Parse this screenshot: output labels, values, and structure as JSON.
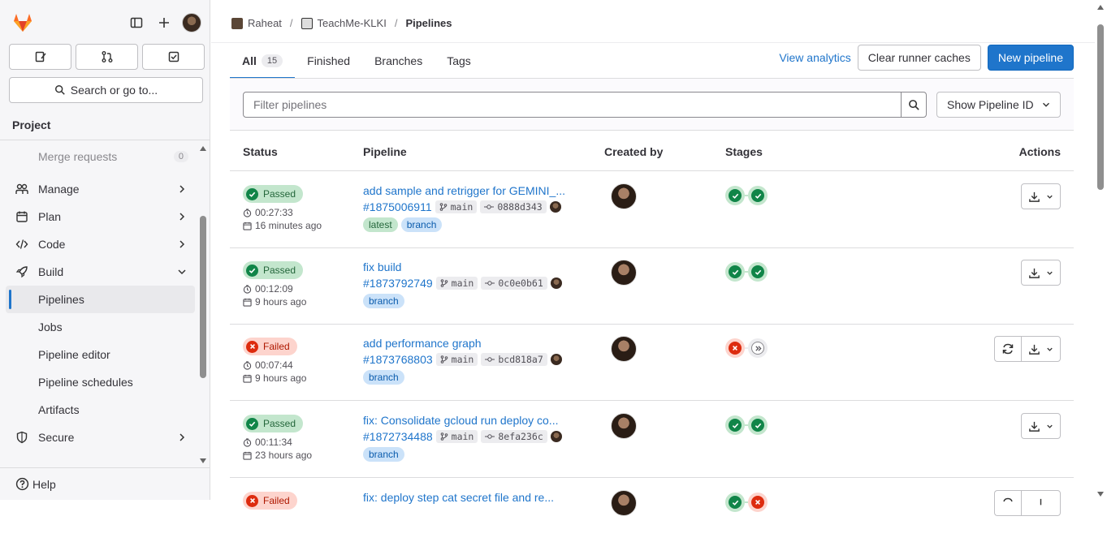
{
  "sidebar": {
    "search_label": "Search or go to...",
    "section_title": "Project",
    "items": [
      {
        "label": "Merge requests",
        "count": "0"
      },
      {
        "label": "Manage"
      },
      {
        "label": "Plan"
      },
      {
        "label": "Code"
      },
      {
        "label": "Build"
      },
      {
        "label": "Pipelines"
      },
      {
        "label": "Jobs"
      },
      {
        "label": "Pipeline editor"
      },
      {
        "label": "Pipeline schedules"
      },
      {
        "label": "Artifacts"
      },
      {
        "label": "Secure"
      }
    ],
    "help_label": "Help"
  },
  "breadcrumb": {
    "user": "Raheat",
    "project": "TeachMe-KLKI",
    "current": "Pipelines"
  },
  "tabs": [
    {
      "label": "All",
      "count": "15"
    },
    {
      "label": "Finished"
    },
    {
      "label": "Branches"
    },
    {
      "label": "Tags"
    }
  ],
  "actions": {
    "view_analytics": "View analytics",
    "clear_caches": "Clear runner caches",
    "new_pipeline": "New pipeline"
  },
  "filter": {
    "placeholder": "Filter pipelines",
    "show_id": "Show Pipeline ID"
  },
  "columns": {
    "status": "Status",
    "pipeline": "Pipeline",
    "created_by": "Created by",
    "stages": "Stages",
    "actions": "Actions"
  },
  "rows": [
    {
      "status": "Passed",
      "duration": "00:27:33",
      "ago": "16 minutes ago",
      "title": "add sample and retrigger for GEMINI_...",
      "id": "#1875006911",
      "branch": "main",
      "sha": "0888d343",
      "labels": [
        "latest",
        "branch"
      ]
    },
    {
      "status": "Passed",
      "duration": "00:12:09",
      "ago": "9 hours ago",
      "title": "fix build",
      "id": "#1873792749",
      "branch": "main",
      "sha": "0c0e0b61",
      "labels": [
        "branch"
      ]
    },
    {
      "status": "Failed",
      "duration": "00:07:44",
      "ago": "9 hours ago",
      "title": "add performance graph",
      "id": "#1873768803",
      "branch": "main",
      "sha": "bcd818a7",
      "labels": [
        "branch"
      ]
    },
    {
      "status": "Passed",
      "duration": "00:11:34",
      "ago": "23 hours ago",
      "title": "fix: Consolidate gcloud run deploy co...",
      "id": "#1872734488",
      "branch": "main",
      "sha": "8efa236c",
      "labels": [
        "branch"
      ]
    },
    {
      "status": "Failed",
      "title": "fix: deploy step cat secret file and re..."
    }
  ],
  "colors": {
    "accent": "#1f75cb",
    "success": "#108548",
    "danger": "#dd2b0e",
    "brand": "#e24329"
  }
}
